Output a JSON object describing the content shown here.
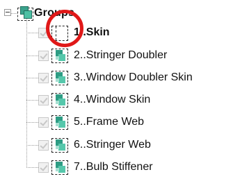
{
  "tree": {
    "root": {
      "label": "Groups",
      "expander": "minus",
      "icon": "group-icon"
    },
    "items": [
      {
        "label": "1..Skin",
        "checked": true,
        "selected": true,
        "icon": "empty-group-icon"
      },
      {
        "label": "2..Stringer Doubler",
        "checked": true,
        "selected": false,
        "icon": "group-icon"
      },
      {
        "label": "3..Window Doubler Skin",
        "checked": true,
        "selected": false,
        "icon": "group-icon"
      },
      {
        "label": "4..Window Skin",
        "checked": true,
        "selected": false,
        "icon": "group-icon"
      },
      {
        "label": "5..Frame Web",
        "checked": true,
        "selected": false,
        "icon": "group-icon"
      },
      {
        "label": "6..Stringer Web",
        "checked": true,
        "selected": false,
        "icon": "group-icon"
      },
      {
        "label": "7..Bulb Stiffener",
        "checked": true,
        "selected": false,
        "icon": "group-icon"
      }
    ]
  },
  "annotation": {
    "shape": "circle",
    "color": "#e01818"
  }
}
